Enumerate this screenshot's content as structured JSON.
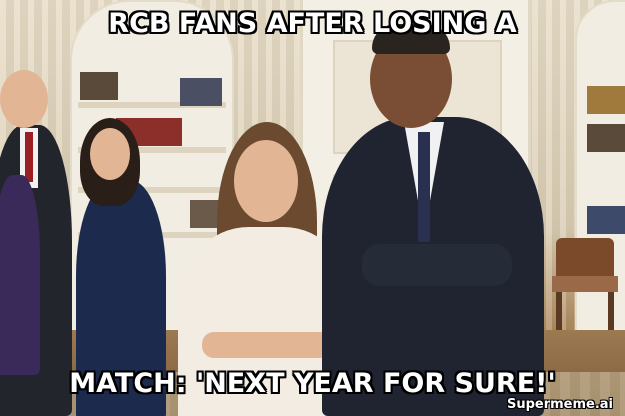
{
  "meme": {
    "top_text": "RCB FANS AFTER LOSING A",
    "bottom_text": "MATCH: 'NEXT YEAR FOR SURE!'",
    "watermark": "Supermeme.ai"
  },
  "colors": {
    "caption_fill": "#ffffff",
    "caption_outline": "#000000",
    "suit_dark": "#1f2430",
    "dress_navy": "#1c2a4d",
    "dress_lace": "#f3ece2",
    "wall": "#e7dcc6"
  }
}
